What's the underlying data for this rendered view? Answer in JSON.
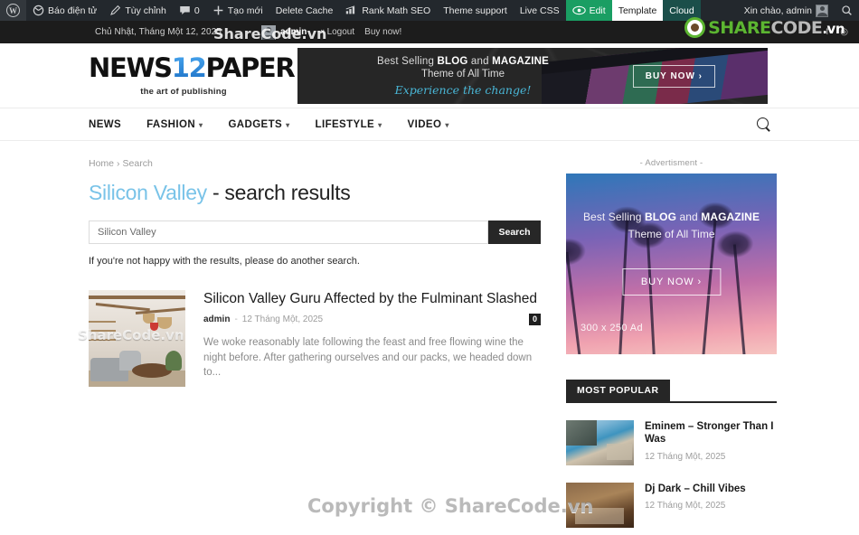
{
  "adminbar": {
    "wp_logo": "W",
    "items": [
      {
        "label": "Báo điện tử",
        "icon": "dashboard-icon"
      },
      {
        "label": "Tùy chỉnh",
        "icon": "pencil-icon"
      },
      {
        "label": "0",
        "icon": "comment-icon"
      },
      {
        "label": "Tạo mới",
        "icon": "plus-icon"
      },
      {
        "label": "Delete Cache",
        "icon": "none"
      },
      {
        "label": "Rank Math SEO",
        "icon": "rankmath-icon"
      },
      {
        "label": "Theme support",
        "icon": "none"
      },
      {
        "label": "Live CSS",
        "icon": "none"
      }
    ],
    "edit_label": "Edit",
    "template_label": "Template",
    "cloud_label": "Cloud",
    "greeting": "Xin chào, admin",
    "search_icon": "search-icon"
  },
  "topstrip": {
    "date": "Chủ Nhật, Tháng Một 12, 2025",
    "user": "admin",
    "logout": "Logout",
    "buy_now": "Buy now!",
    "social": [
      "f",
      "◎"
    ]
  },
  "brand_overlay": {
    "share": "SHARE",
    "code": "CODE",
    "vn": ".vn"
  },
  "watermarks": {
    "top": "ShareCode.vn",
    "thumb": "ShareCode.vn",
    "center": "Copyright © ShareCode.vn"
  },
  "header": {
    "logo_news": "NEWS",
    "logo_12": "12",
    "logo_paper": "PAPER",
    "tagline": "the art of publishing",
    "ad": {
      "line1_pre": "Best Selling ",
      "line1_b1": "BLOG",
      "line1_mid": " and ",
      "line1_b2": "MAGAZINE",
      "line2": "Theme of All Time",
      "line3": "Experience the change!",
      "buy": "BUY NOW ›"
    }
  },
  "nav": {
    "items": [
      {
        "label": "NEWS",
        "has_dropdown": false
      },
      {
        "label": "FASHION",
        "has_dropdown": true
      },
      {
        "label": "GADGETS",
        "has_dropdown": true
      },
      {
        "label": "LIFESTYLE",
        "has_dropdown": true
      },
      {
        "label": "VIDEO",
        "has_dropdown": true
      }
    ],
    "search_icon": "search-icon"
  },
  "breadcrumb": {
    "home": "Home",
    "separator": "›",
    "current": "Search"
  },
  "page_title": {
    "term": "Silicon Valley",
    "suffix": " - search results"
  },
  "search": {
    "value": "Silicon Valley",
    "placeholder": "Search",
    "button": "Search",
    "note": "If you're not happy with the results, please do another search."
  },
  "results": [
    {
      "title": "Silicon Valley Guru Affected by the Fulminant Slashed",
      "author": "admin",
      "dash": "-",
      "date": "12 Tháng Một, 2025",
      "comments": "0",
      "excerpt": "We woke reasonably late following the feast and free flowing wine the night before. After gathering ourselves and our packs, we headed down to..."
    }
  ],
  "sidebar": {
    "ad_label": "- Advertisment -",
    "ad": {
      "line1_pre": "Best Selling ",
      "line1_b1": "BLOG",
      "line1_mid": " and ",
      "line1_b2": "MAGAZINE",
      "line2": "Theme of All Time",
      "buy": "BUY NOW  ›",
      "size": "300 x 250 Ad"
    },
    "widget_title": "MOST POPULAR",
    "popular": [
      {
        "title": "Eminem – Stronger Than I Was",
        "date": "12 Tháng Một, 2025",
        "thumb": "pool"
      },
      {
        "title": "Dj Dark – Chill Vibes",
        "date": "12 Tháng Một, 2025",
        "thumb": "room"
      }
    ]
  },
  "colors": {
    "accent": "#79c3e8",
    "adminbar_bg": "#23282d",
    "green": "#1a9e63",
    "sharecode_green": "#5cb531"
  }
}
